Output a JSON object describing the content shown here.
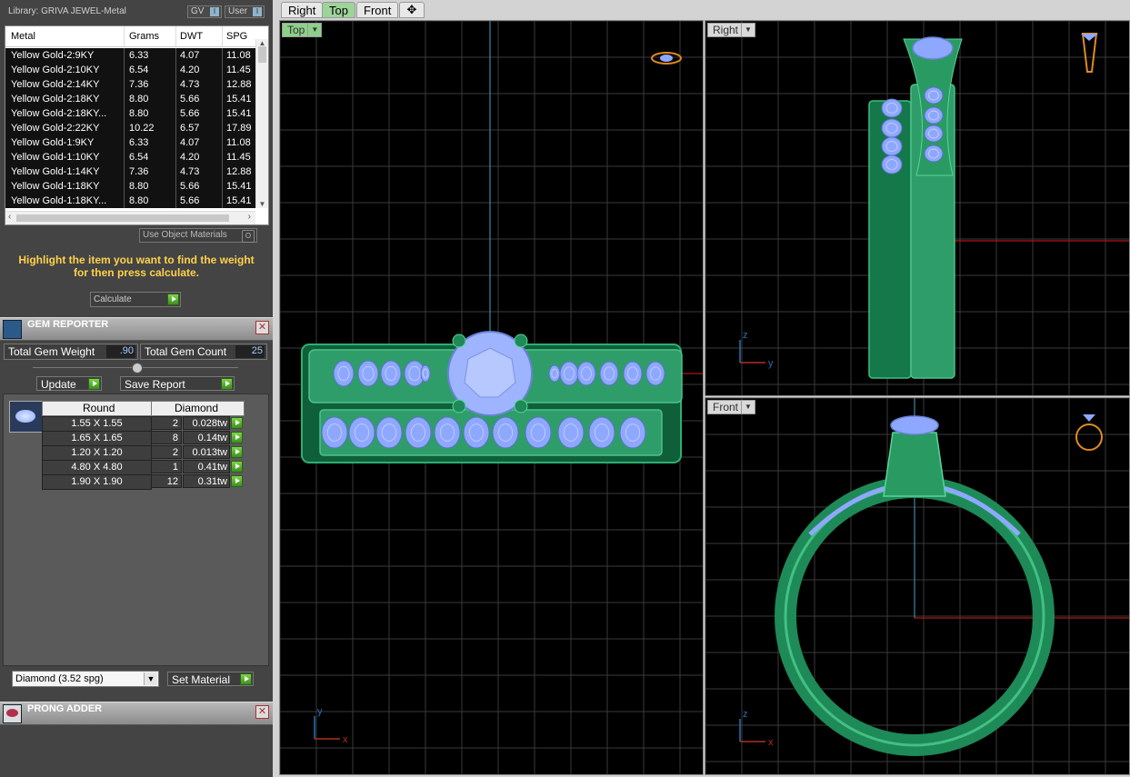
{
  "library": {
    "title": "Library: GRIVA JEWEL-Metal",
    "gv_label": "GV",
    "user_label": "User",
    "toggle_glyph": "I"
  },
  "metal_table": {
    "headers": [
      "Metal",
      "Grams",
      "DWT",
      "SPG"
    ],
    "rows": [
      [
        "Yellow Gold-2:9KY",
        "6.33",
        "4.07",
        "11.08"
      ],
      [
        "Yellow Gold-2:10KY",
        "6.54",
        "4.20",
        "11.45"
      ],
      [
        "Yellow Gold-2:14KY",
        "7.36",
        "4.73",
        "12.88"
      ],
      [
        "Yellow Gold-2:18KY",
        "8.80",
        "5.66",
        "15.41"
      ],
      [
        "Yellow Gold-2:18KY...",
        "8.80",
        "5.66",
        "15.41"
      ],
      [
        "Yellow Gold-2:22KY",
        "10.22",
        "6.57",
        "17.89"
      ],
      [
        "Yellow Gold-1:9KY",
        "6.33",
        "4.07",
        "11.08"
      ],
      [
        "Yellow Gold-1:10KY",
        "6.54",
        "4.20",
        "11.45"
      ],
      [
        "Yellow Gold-1:14KY",
        "7.36",
        "4.73",
        "12.88"
      ],
      [
        "Yellow Gold-1:18KY",
        "8.80",
        "5.66",
        "15.41"
      ],
      [
        "Yellow Gold-1:18KY...",
        "8.80",
        "5.66",
        "15.41"
      ]
    ]
  },
  "use_object_materials": {
    "label": "Use Object Materials",
    "glyph": "O"
  },
  "hint": "Highlight the item you want to find the weight for then press calculate.",
  "calculate_label": "Calculate",
  "gem_reporter": {
    "title": "GEM REPORTER",
    "total_weight_label": "Total Gem Weight",
    "total_weight_value": ".90",
    "total_count_label": "Total Gem Count",
    "total_count_value": "25",
    "update_label": "Update",
    "save_report_label": "Save Report",
    "table_headers": [
      "Round",
      "Diamond"
    ],
    "rows": [
      {
        "size": "1.55 X 1.55",
        "count": "2",
        "weight": "0.028tw"
      },
      {
        "size": "1.65 X 1.65",
        "count": "8",
        "weight": "0.14tw"
      },
      {
        "size": "1.20 X 1.20",
        "count": "2",
        "weight": "0.013tw"
      },
      {
        "size": "4.80 X 4.80",
        "count": "1",
        "weight": "0.41tw"
      },
      {
        "size": "1.90 X 1.90",
        "count": "12",
        "weight": "0.31tw"
      }
    ],
    "material_select": "Diamond    (3.52 spg)",
    "set_material_label": "Set Material"
  },
  "prong_adder": {
    "title": "PRONG ADDER"
  },
  "tabs": [
    {
      "label": "Right",
      "active": false
    },
    {
      "label": "Top",
      "active": true
    },
    {
      "label": "Front",
      "active": false
    }
  ],
  "add_tab_glyph": "✥",
  "viewports": {
    "top": {
      "label": "Top",
      "axis1": "y",
      "axis2": "x"
    },
    "right": {
      "label": "Right",
      "axis1": "z",
      "axis2": "y"
    },
    "front": {
      "label": "Front",
      "axis1": "z",
      "axis2": "x"
    }
  },
  "colors": {
    "metal_green": "#2f9d6a",
    "gem_blue": "#8fa8ff",
    "axis_cyan": "#3a8aa0",
    "axis_red": "#b01515",
    "hint_yellow": "#ffd24a"
  }
}
